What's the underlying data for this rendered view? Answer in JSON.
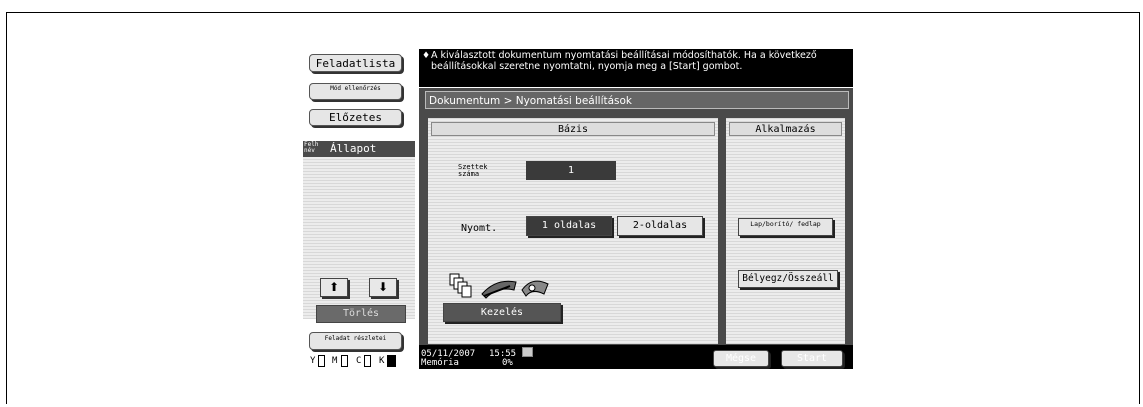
{
  "left": {
    "job_list": "Feladatlista",
    "check_mode": "Mód ellenőrzés",
    "preview": "Előzetes",
    "user_name": "Felh név",
    "status": "Állapot",
    "delete": "Törlés",
    "job_details": "Feladat részletei",
    "toner": [
      "Y",
      "M",
      "C",
      "K"
    ]
  },
  "message": "A kiválasztott dokumentum nyomtatási beállításai módosíthatók. Ha a következő beállításokkal szeretne nyomtatni, nyomja meg a [Start] gombot.",
  "breadcrumb": "Dokumentum > Nyomatási beállítások",
  "basis": {
    "header": "Bázis",
    "sets_label": "Szettek száma",
    "sets_value": "1",
    "print_label": "Nyomt.",
    "one_sided": "1 oldalas",
    "two_sided": "2-oldalas",
    "finishing": "Kezelés"
  },
  "application": {
    "header": "Alkalmazás",
    "sheet_cover": "Lap/borító/ fedlap",
    "stamp_compose": "Bélyegz/Összeáll"
  },
  "footer": {
    "date": "05/11/2007",
    "time": "15:55",
    "memory_label": "Memória",
    "memory_value": "0%",
    "cancel": "Mégse",
    "start": "Start"
  }
}
